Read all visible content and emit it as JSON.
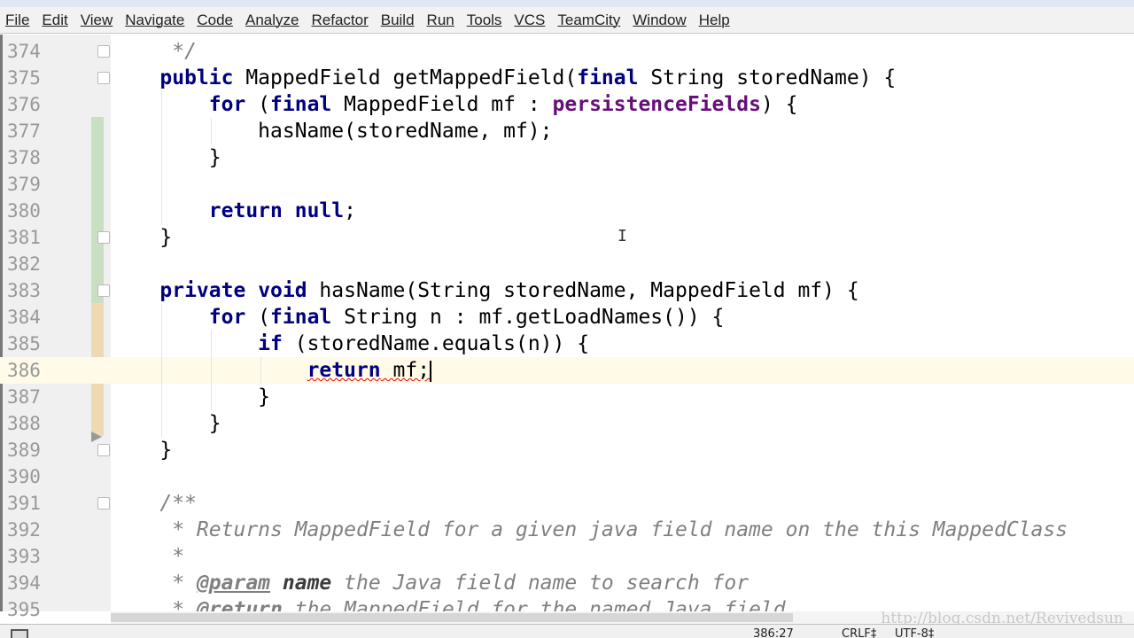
{
  "menu": [
    "File",
    "Edit",
    "View",
    "Navigate",
    "Code",
    "Analyze",
    "Refactor",
    "Build",
    "Run",
    "Tools",
    "VCS",
    "TeamCity",
    "Window",
    "Help"
  ],
  "editor": {
    "current_line": "386",
    "lines": [
      {
        "n": "374",
        "t": [
          [
            "    ",
            ""
          ],
          [
            " */",
            "cm"
          ]
        ]
      },
      {
        "n": "375",
        "t": [
          [
            "    ",
            ""
          ],
          [
            "public",
            "kw"
          ],
          [
            " MappedField getMappedField(",
            ""
          ],
          [
            "final",
            "kw"
          ],
          [
            " String storedName) {",
            ""
          ]
        ]
      },
      {
        "n": "376",
        "t": [
          [
            "        ",
            ""
          ],
          [
            "for",
            "kw"
          ],
          [
            " (",
            ""
          ],
          [
            "final",
            "kw"
          ],
          [
            " MappedField mf : ",
            ""
          ],
          [
            "persistenceFields",
            "fld"
          ],
          [
            ") {",
            ""
          ]
        ]
      },
      {
        "n": "377",
        "t": [
          [
            "            hasName(storedName, mf);",
            ""
          ]
        ]
      },
      {
        "n": "378",
        "t": [
          [
            "        }",
            ""
          ]
        ]
      },
      {
        "n": "379",
        "t": [
          [
            "",
            ""
          ]
        ]
      },
      {
        "n": "380",
        "t": [
          [
            "        ",
            ""
          ],
          [
            "return",
            "kw"
          ],
          [
            " ",
            ""
          ],
          [
            "null",
            "kw"
          ],
          [
            ";",
            ""
          ]
        ]
      },
      {
        "n": "381",
        "t": [
          [
            "    }",
            ""
          ]
        ]
      },
      {
        "n": "382",
        "t": [
          [
            "",
            ""
          ]
        ]
      },
      {
        "n": "383",
        "t": [
          [
            "    ",
            ""
          ],
          [
            "private",
            "kw"
          ],
          [
            " ",
            ""
          ],
          [
            "void",
            "kw"
          ],
          [
            " hasName(String storedName, MappedField mf) {",
            ""
          ]
        ]
      },
      {
        "n": "384",
        "t": [
          [
            "        ",
            ""
          ],
          [
            "for",
            "kw"
          ],
          [
            " (",
            ""
          ],
          [
            "final",
            "kw"
          ],
          [
            " String n : mf.getLoadNames()) {",
            ""
          ]
        ]
      },
      {
        "n": "385",
        "t": [
          [
            "            ",
            ""
          ],
          [
            "if",
            "kw"
          ],
          [
            " (storedName.equals(n)) {",
            ""
          ]
        ]
      },
      {
        "n": "386",
        "t": [
          [
            "                ",
            ""
          ],
          [
            "return",
            "kw err"
          ],
          [
            " mf;",
            "err"
          ]
        ]
      },
      {
        "n": "387",
        "t": [
          [
            "            }",
            ""
          ]
        ]
      },
      {
        "n": "388",
        "t": [
          [
            "        }",
            ""
          ]
        ]
      },
      {
        "n": "389",
        "t": [
          [
            "    }",
            ""
          ]
        ]
      },
      {
        "n": "390",
        "t": [
          [
            "",
            ""
          ]
        ]
      },
      {
        "n": "391",
        "t": [
          [
            "    ",
            ""
          ],
          [
            "/**",
            "cm"
          ]
        ]
      },
      {
        "n": "392",
        "t": [
          [
            "    ",
            ""
          ],
          [
            " * Returns MappedField for a given java field name on the this MappedClass",
            "cm"
          ]
        ]
      },
      {
        "n": "393",
        "t": [
          [
            "    ",
            ""
          ],
          [
            " *",
            "cm"
          ]
        ]
      },
      {
        "n": "394",
        "t": [
          [
            "    ",
            ""
          ],
          [
            " * ",
            "cm"
          ],
          [
            "@param",
            "tag"
          ],
          [
            " ",
            "cm"
          ],
          [
            "name",
            "tagv"
          ],
          [
            " the Java field name to search for",
            "cm"
          ]
        ]
      },
      {
        "n": "395",
        "t": [
          [
            "    ",
            ""
          ],
          [
            " * ",
            "cm"
          ],
          [
            "@return",
            "tag"
          ],
          [
            " the MappedField for the named Java field",
            "cm"
          ]
        ]
      }
    ]
  },
  "colors": {
    "added": "#c9dfc4",
    "modified": "#eed9b3",
    "current_line_bg": "#fffbe8",
    "keyword": "#000080",
    "field": "#660e7a"
  },
  "watermark": "http://blog.csdn.net/Revivedsun",
  "status": {
    "position": "386:27",
    "line_separator": "CRLF‡",
    "encoding": "UTF-8‡"
  }
}
